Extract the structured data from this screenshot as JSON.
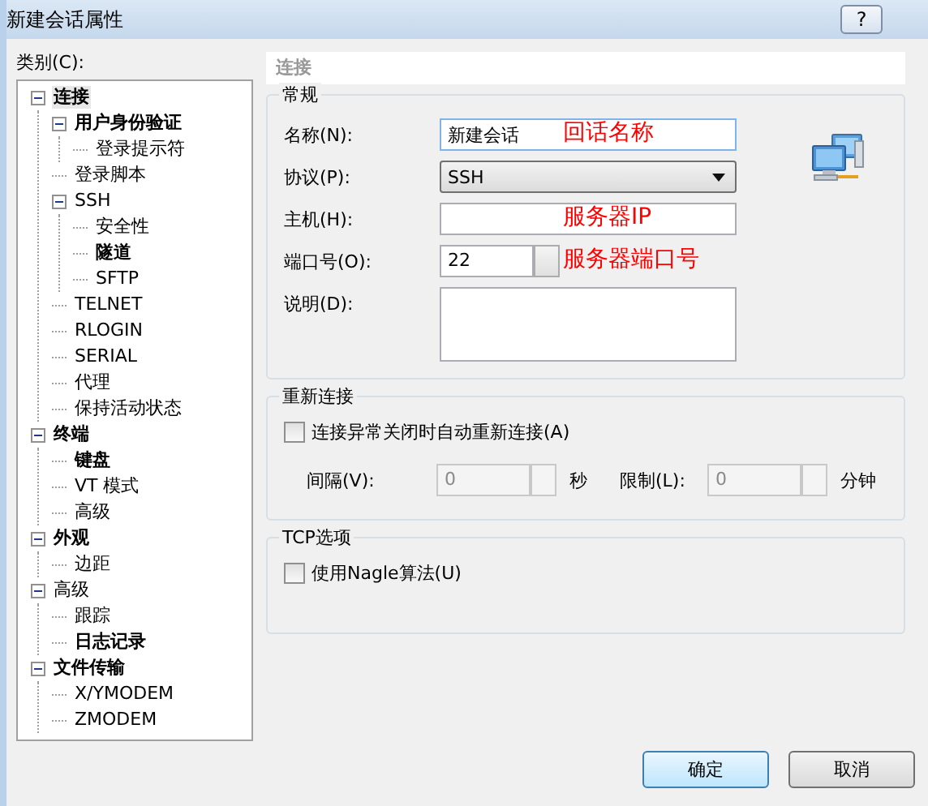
{
  "window": {
    "title": "新建会话属性",
    "help": "?"
  },
  "category_label": "类别(C):",
  "tree": [
    {
      "label": "连接",
      "bold": true,
      "selected": true,
      "expanded": true,
      "children": [
        {
          "label": "用户身份验证",
          "bold": true,
          "selected": false,
          "expanded": true,
          "children": [
            {
              "label": "登录提示符",
              "bold": false,
              "selected": false
            }
          ]
        },
        {
          "label": "登录脚本",
          "bold": false,
          "selected": false
        },
        {
          "label": "SSH",
          "bold": false,
          "selected": false,
          "expanded": true,
          "children": [
            {
              "label": "安全性",
              "bold": false,
              "selected": false
            },
            {
              "label": "隧道",
              "bold": true,
              "selected": false
            },
            {
              "label": "SFTP",
              "bold": false,
              "selected": false
            }
          ]
        },
        {
          "label": "TELNET",
          "bold": false,
          "selected": false
        },
        {
          "label": "RLOGIN",
          "bold": false,
          "selected": false
        },
        {
          "label": "SERIAL",
          "bold": false,
          "selected": false
        },
        {
          "label": "代理",
          "bold": false,
          "selected": false
        },
        {
          "label": "保持活动状态",
          "bold": false,
          "selected": false
        }
      ]
    },
    {
      "label": "终端",
      "bold": true,
      "selected": false,
      "expanded": true,
      "children": [
        {
          "label": "键盘",
          "bold": true,
          "selected": false
        },
        {
          "label": "VT 模式",
          "bold": false,
          "selected": false
        },
        {
          "label": "高级",
          "bold": false,
          "selected": false
        }
      ]
    },
    {
      "label": "外观",
      "bold": true,
      "selected": false,
      "expanded": true,
      "children": [
        {
          "label": "边距",
          "bold": false,
          "selected": false
        }
      ]
    },
    {
      "label": "高级",
      "bold": false,
      "selected": false,
      "expanded": true,
      "children": [
        {
          "label": "跟踪",
          "bold": false,
          "selected": false
        },
        {
          "label": "日志记录",
          "bold": true,
          "selected": false
        }
      ]
    },
    {
      "label": "文件传输",
      "bold": true,
      "selected": false,
      "expanded": true,
      "children": [
        {
          "label": "X/YMODEM",
          "bold": false,
          "selected": false
        },
        {
          "label": "ZMODEM",
          "bold": false,
          "selected": false
        }
      ]
    }
  ],
  "panel_title": "连接",
  "general": {
    "title": "常规",
    "fields": [
      {
        "kind": "text",
        "label": "名称(N):",
        "value": "新建会话",
        "annotation": "回话名称"
      },
      {
        "kind": "select",
        "label": "协议(P):",
        "value": "SSH"
      },
      {
        "kind": "text",
        "label": "主机(H):",
        "annotation": "服务器IP"
      },
      {
        "kind": "spin",
        "label": "端口号(O):",
        "value": "22",
        "annotation": "服务器端口号"
      },
      {
        "kind": "textarea",
        "label": "说明(D):"
      }
    ]
  },
  "reconnect": {
    "title": "重新连接",
    "checkbox": {
      "label": "连接异常关闭时自动重新连接(A)",
      "checked": false
    },
    "spins": [
      {
        "label": "间隔(V):",
        "value": "0",
        "unit": "秒",
        "disabled": true
      },
      {
        "label": "限制(L):",
        "value": "0",
        "unit": "分钟",
        "disabled": true
      }
    ]
  },
  "tcp": {
    "title": "TCP选项",
    "checkbox": {
      "label": "使用Nagle算法(U)",
      "checked": false
    }
  },
  "buttons": [
    {
      "label": "确定",
      "default": true
    },
    {
      "label": "取消",
      "default": false
    }
  ]
}
